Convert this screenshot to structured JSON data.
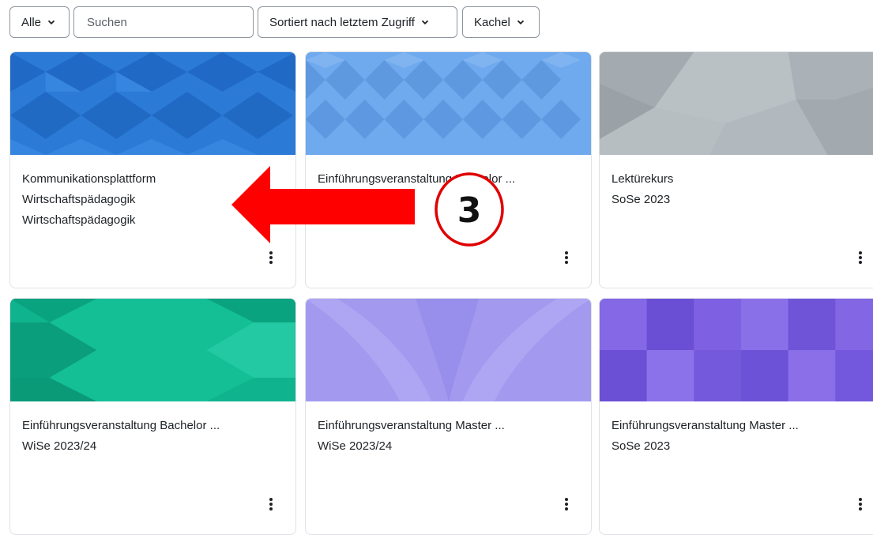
{
  "filters": {
    "grouping_label": "Alle",
    "search_placeholder": "Suchen",
    "sort_label": "Sortiert nach letztem Zugriff",
    "view_label": "Kachel"
  },
  "courses": [
    {
      "title": "Kommunikationsplattform",
      "subtitle": "Wirtschaftspädagogik",
      "category": "Wirtschaftspädagogik",
      "color": "#2b7bd6"
    },
    {
      "title": "Einführungsveranstaltung Bachelor ...",
      "subtitle": "",
      "category": "",
      "color": "#6fa9ee"
    },
    {
      "title": "Lektürekurs",
      "subtitle": "SoSe 2023",
      "category": "",
      "color": "#b1b9be"
    },
    {
      "title": "Einführungsveranstaltung Bachelor ...",
      "subtitle": "WiSe 2023/24",
      "category": "",
      "color": "#0fb48e"
    },
    {
      "title": "Einführungsveranstaltung Master ...",
      "subtitle": "WiSe 2023/24",
      "category": "",
      "color": "#a39af0"
    },
    {
      "title": "Einführungsveranstaltung Master ...",
      "subtitle": "SoSe 2023",
      "category": "",
      "color": "#7a5ee0"
    }
  ],
  "annotation": {
    "step_number": "3",
    "arrow_color": "#ff0000"
  }
}
